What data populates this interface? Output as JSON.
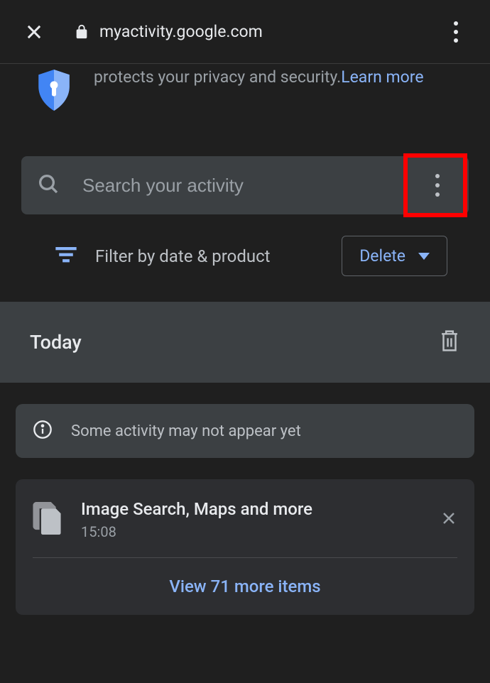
{
  "browser": {
    "url": "myactivity.google.com"
  },
  "privacy_banner": {
    "text_line1": "protects your privacy and security. ",
    "learn_more": "Learn more"
  },
  "search": {
    "placeholder": "Search your activity"
  },
  "filter": {
    "label": "Filter by date & product",
    "delete_label": "Delete"
  },
  "today": {
    "title": "Today"
  },
  "info": {
    "text": "Some activity may not appear yet"
  },
  "activity": {
    "title": "Image Search, Maps and more",
    "time": "15:08",
    "view_more": "View 71 more items"
  }
}
